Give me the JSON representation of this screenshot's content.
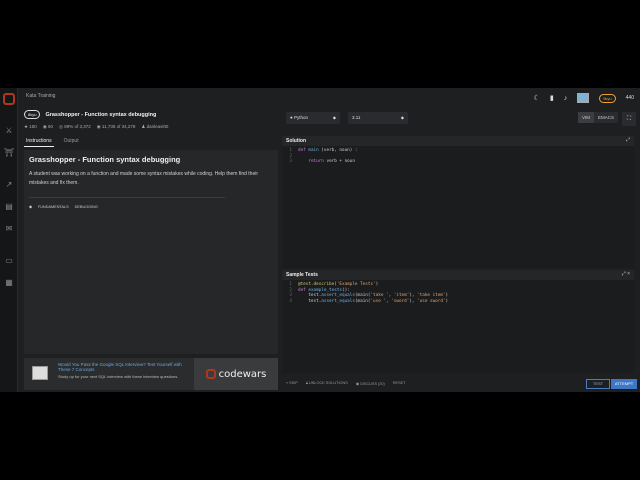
{
  "header": {
    "kata_training_label": "Kata Training",
    "rank": "9kyu",
    "honor": "440"
  },
  "kata": {
    "kyu": "8kyu",
    "title": "Grasshopper - Function syntax debugging",
    "stats": {
      "rank_count": "150",
      "stars": "60",
      "satisfaction": "89% of 3,372",
      "completions": "11,735 of 34,278",
      "author": "danleavitt0"
    }
  },
  "tabs": [
    "Instructions",
    "Output"
  ],
  "description": {
    "title": "Grasshopper - Function syntax debugging",
    "text": "A student was working on a function and made some syntax mistakes while coding. Help them find their mistakes and fix them.",
    "tags": [
      "FUNDAMENTALS",
      "DEBUGGING"
    ]
  },
  "ad": {
    "title": "Would You Pass the Google SQL Interview? Test Yourself with These 7 Concepts",
    "subtitle": "Study up for your next SQL interview with these interview questions.",
    "brand": "codewars"
  },
  "editor": {
    "language": "Python",
    "version": "3.11",
    "modes": [
      "VIM",
      "EMACS"
    ],
    "solution_label": "Solution",
    "sample_tests_label": "Sample Tests"
  },
  "bottom": {
    "skip": "SKIP",
    "unlock": "UNLOCK SOLUTIONS",
    "discuss": "DISCUSS (20)",
    "reset": "RESET",
    "test": "TEST",
    "attempt": "ATTEMPT"
  }
}
